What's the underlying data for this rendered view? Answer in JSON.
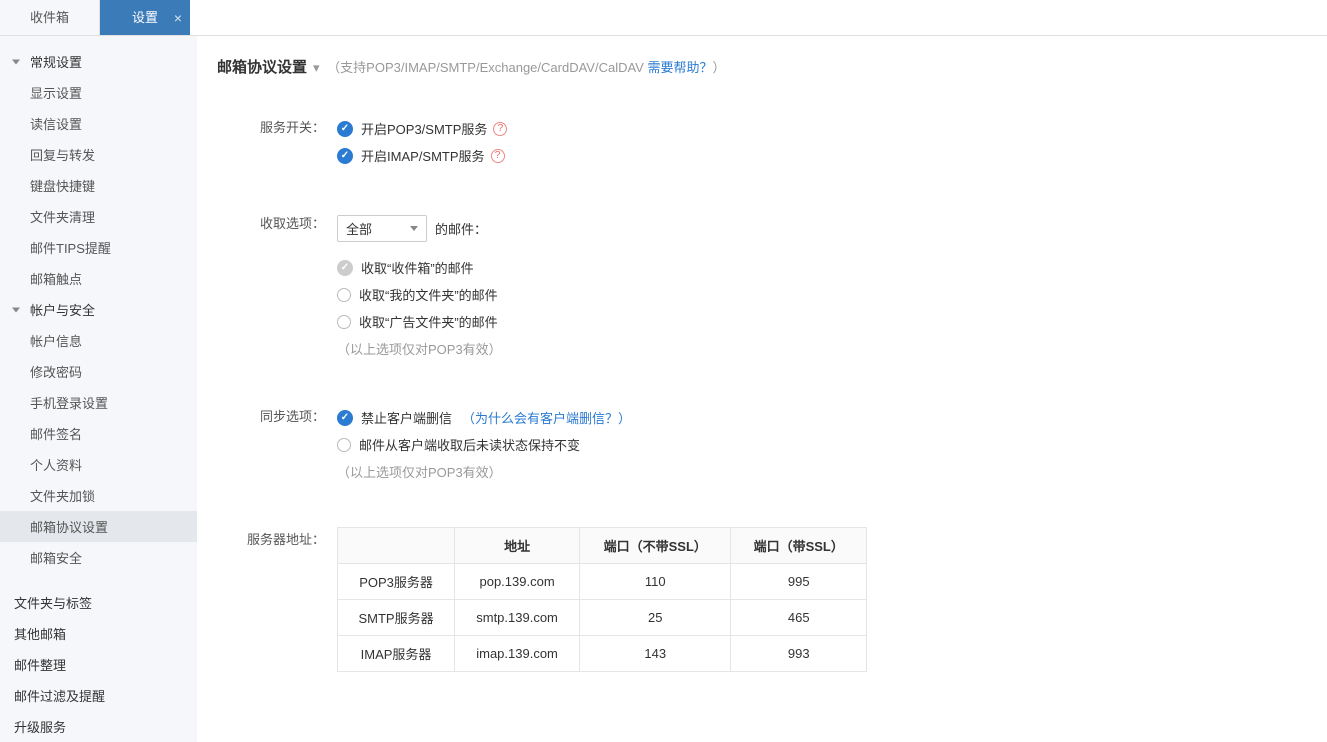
{
  "tabs": {
    "inbox": "收件箱",
    "settings": "设置"
  },
  "sidebar": {
    "group_general": "常规设置",
    "general_items": [
      "显示设置",
      "读信设置",
      "回复与转发",
      "键盘快捷键",
      "文件夹清理",
      "邮件TIPS提醒",
      "邮箱触点"
    ],
    "group_account": "帐户与安全",
    "account_items": [
      "帐户信息",
      "修改密码",
      "手机登录设置",
      "邮件签名",
      "个人资料",
      "文件夹加锁",
      "邮箱协议设置",
      "邮箱安全"
    ],
    "top_items": [
      "文件夹与标签",
      "其他邮箱",
      "邮件整理",
      "邮件过滤及提醒",
      "升级服务"
    ],
    "selected": "邮箱协议设置"
  },
  "header": {
    "title": "邮箱协议设置",
    "subtitle_prefix": "（支持POP3/IMAP/SMTP/Exchange/CardDAV/CalDAV ",
    "help": "需要帮助？",
    "subtitle_suffix": "）"
  },
  "service": {
    "label": "服务开关：",
    "opt1": "开启POP3/SMTP服务",
    "opt2": "开启IMAP/SMTP服务",
    "q": "?"
  },
  "receive": {
    "label": "收取选项：",
    "select_value": "全部",
    "suffix": "的邮件：",
    "r1": "收取“收件箱”的邮件",
    "r2": "收取“我的文件夹”的邮件",
    "r3": "收取“广告文件夹”的邮件",
    "note": "（以上选项仅对POP3有效）"
  },
  "sync": {
    "label": "同步选项：",
    "s1": "禁止客户端删信",
    "link_open": "（",
    "link": "为什么会有客户端删信？",
    "link_close": "）",
    "s2": "邮件从客户端收取后未读状态保持不变",
    "note": "（以上选项仅对POP3有效）"
  },
  "server": {
    "label": "服务器地址：",
    "th1": "地址",
    "th2": "端口（不带SSL）",
    "th3": "端口（带SSL）",
    "rows": [
      {
        "name": "POP3服务器",
        "addr": "pop.139.com",
        "p1": "110",
        "p2": "995"
      },
      {
        "name": "SMTP服务器",
        "addr": "smtp.139.com",
        "p1": "25",
        "p2": "465"
      },
      {
        "name": "IMAP服务器",
        "addr": "imap.139.com",
        "p1": "143",
        "p2": "993"
      }
    ]
  }
}
